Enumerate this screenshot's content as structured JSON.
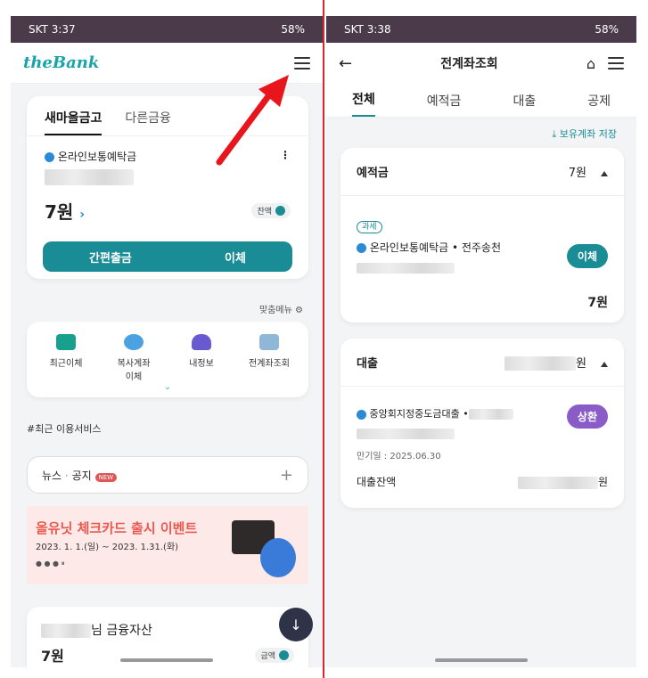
{
  "left": {
    "status": {
      "time": "SKT 3:37",
      "battery": "58%"
    },
    "app": {
      "logo": "theBank"
    },
    "account_card": {
      "tabs": [
        "새마을금고",
        "다른금융"
      ],
      "account_type": "온라인보통예탁금",
      "balance": "7원",
      "balance_toggle": "잔액",
      "buttons": [
        "간편출금",
        "이체"
      ]
    },
    "custom_menu": "맞춤메뉴",
    "quick_menu": [
      "최근이체",
      "복사계좌\n이체",
      "내정보",
      "전계좌조회"
    ],
    "recent_services": "#최근 이용서비스",
    "news": {
      "label": "뉴스",
      "notice": "공지",
      "badge": "NEW"
    },
    "banner": {
      "title": "올유닛 체크카드 출시 이벤트",
      "period": "2023. 1. 1.(일) ~ 2023. 1.31.(화)"
    },
    "assets": {
      "title_suffix": "님 금융자산",
      "amount": "7원",
      "toggle": "금액"
    }
  },
  "right": {
    "status": {
      "time": "SKT 3:38",
      "battery": "58%"
    },
    "title": "전계좌조회",
    "tabs": [
      "전체",
      "예적금",
      "대출",
      "공제"
    ],
    "save_holding": "보유계좌 저장",
    "deposit": {
      "header": "예적금",
      "total": "7원",
      "tag": "과세",
      "account": "온라인보통예탁금 • 전주송천",
      "action": "이체",
      "amount": "7원"
    },
    "loan": {
      "header": "대출",
      "total_suffix": "원",
      "account": "중앙회지정중도금대출 •",
      "action": "상환",
      "maturity": "만기일 : 2025.06.30",
      "balance_label": "대출잔액",
      "balance_suffix": "원"
    }
  }
}
